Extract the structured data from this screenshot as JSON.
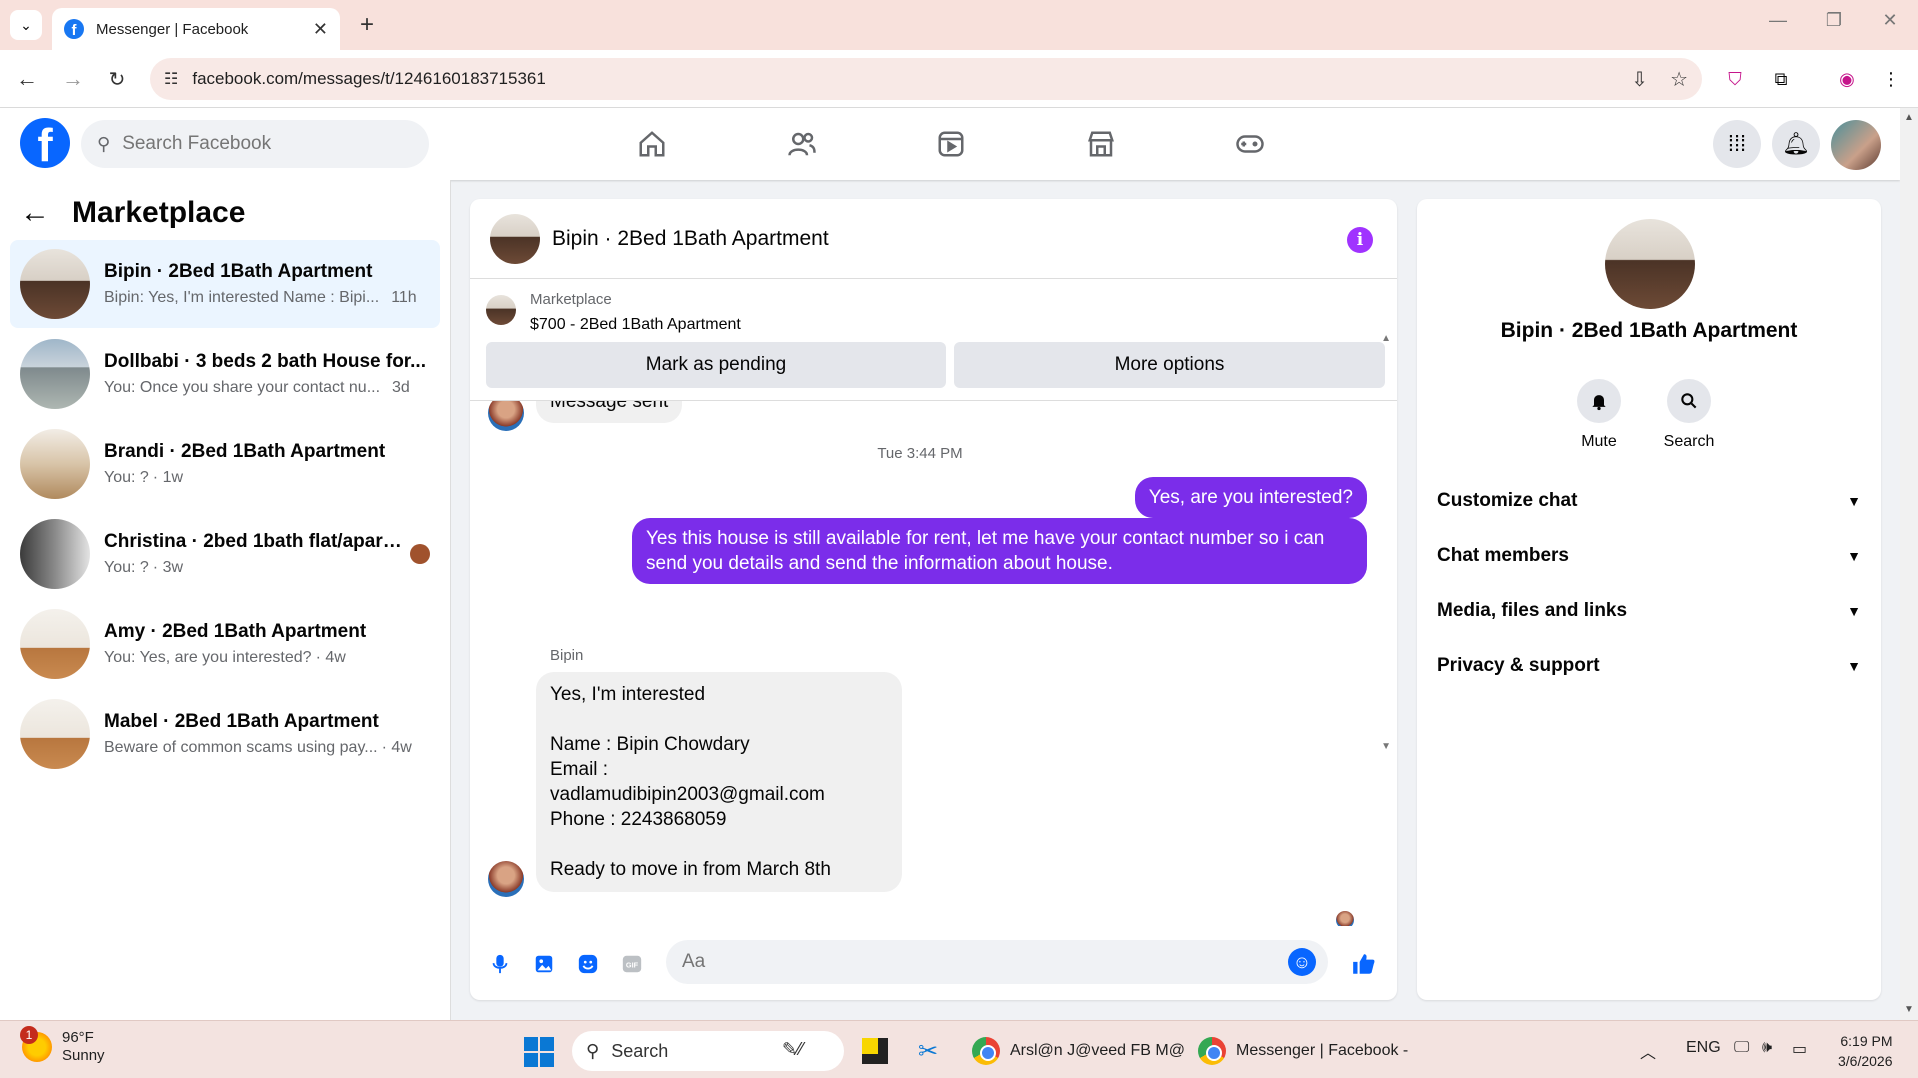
{
  "browser": {
    "tab_title": "Messenger | Facebook",
    "url": "facebook.com/messages/t/1246160183715361"
  },
  "header": {
    "search_placeholder": "Search Facebook"
  },
  "left_panel": {
    "title": "Marketplace",
    "conversations": [
      {
        "name": "Bipin · 2Bed 1Bath Apartment",
        "preview": "Bipin: Yes, I'm interested Name : Bipi...",
        "time": "11h",
        "active": true
      },
      {
        "name": "Dollbabi · 3 beds 2 bath House for...",
        "preview": "You: Once you share your contact nu...",
        "time": "3d",
        "active": false
      },
      {
        "name": "Brandi · 2Bed 1Bath Apartment",
        "preview": "You: ?",
        "time": "· 1w",
        "active": false
      },
      {
        "name": "Christina · 2bed 1bath flat/apart...",
        "preview": "You: ?",
        "time": "· 3w",
        "active": false
      },
      {
        "name": "Amy · 2Bed 1Bath Apartment",
        "preview": "You: Yes, are you interested?",
        "time": "· 4w",
        "active": false
      },
      {
        "name": "Mabel · 2Bed 1Bath Apartment",
        "preview": "Beware of common scams using pay...",
        "time": "· 4w",
        "active": false
      }
    ]
  },
  "chat": {
    "title": "Bipin · 2Bed 1Bath Apartment",
    "marketplace_label": "Marketplace",
    "listing": "$700 - 2Bed 1Bath Apartment",
    "mark_pending": "Mark as pending",
    "more_options": "More options",
    "partial_message": "Message sent",
    "timestamp": "Tue 3:44 PM",
    "out_messages": [
      "Yes, are you interested?",
      "Yes this house is still available for rent, let me have your contact number so i can send you details and send the information about house."
    ],
    "sender": "Bipin",
    "in_message_lines": [
      "Yes, I'm interested",
      "",
      "Name : Bipin Chowdary",
      "Email : vadlamudibipin2003@gmail.com",
      "Phone : 2243868059",
      "",
      "Ready to move in from March 8th"
    ],
    "composer_placeholder": "Aa"
  },
  "right_panel": {
    "name": "Bipin · 2Bed 1Bath Apartment",
    "mute": "Mute",
    "search": "Search",
    "sections": [
      "Customize chat",
      "Chat members",
      "Media, files and links",
      "Privacy & support"
    ]
  },
  "taskbar": {
    "temp": "96°F",
    "condition": "Sunny",
    "weather_badge": "1",
    "search": "Search",
    "app1": "Arsl@n J@veed FB M@",
    "app2": "Messenger | Facebook -",
    "lang": "ENG",
    "time": "6:19 PM",
    "date": "3/6/2026"
  },
  "colors": {
    "fb_blue": "#0866ff",
    "out_bubble": "#7b2dea",
    "active_conv": "#ebf5ff"
  }
}
